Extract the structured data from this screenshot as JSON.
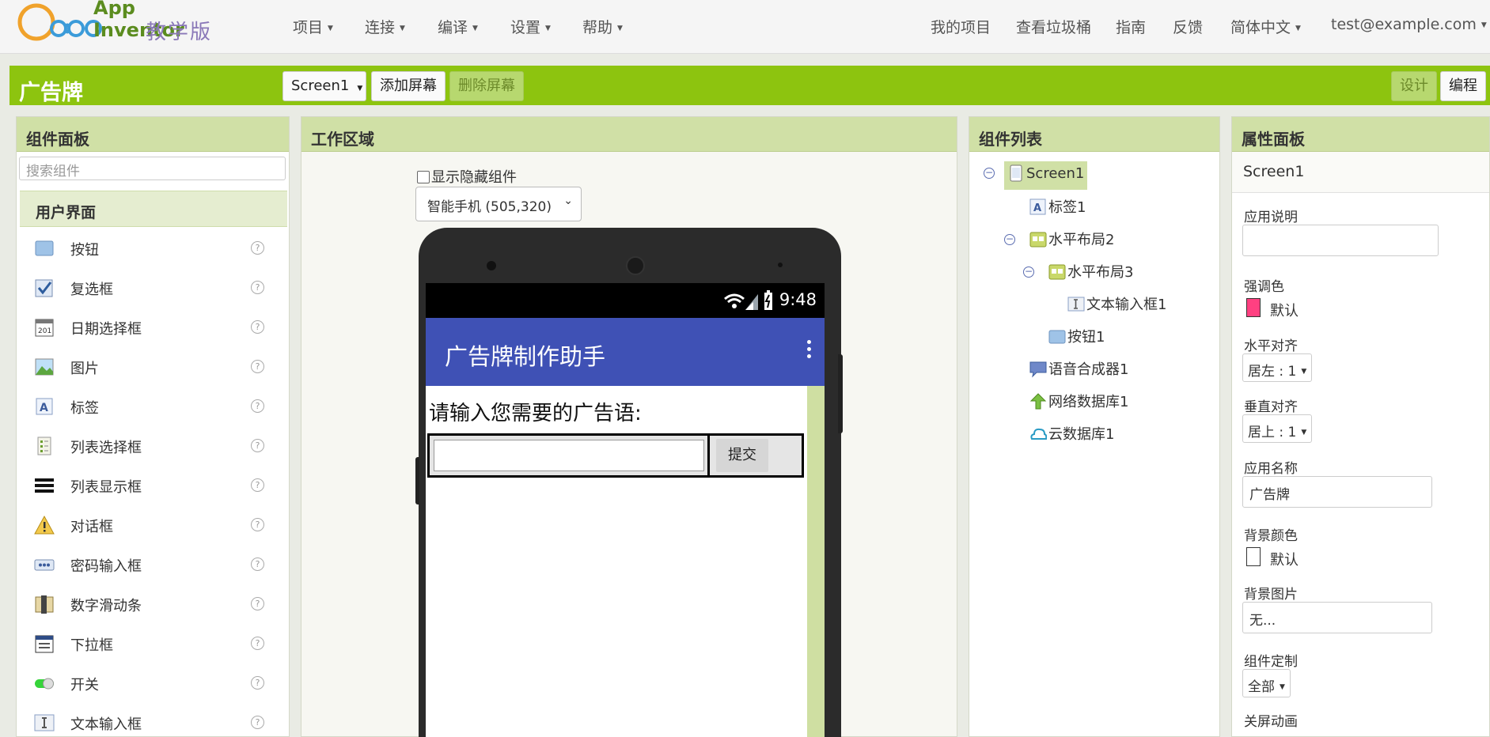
{
  "brand": {
    "title": "App Inventor",
    "subtitle": "教学版"
  },
  "topnav": {
    "menus": [
      {
        "label": "项目"
      },
      {
        "label": "连接"
      },
      {
        "label": "编译"
      },
      {
        "label": "设置"
      },
      {
        "label": "帮助"
      }
    ],
    "links": {
      "my_projects": "我的项目",
      "trash": "查看垃圾桶",
      "guide": "指南",
      "feedback": "反馈",
      "language": "简体中文",
      "user": "test@example.com"
    }
  },
  "toolbar": {
    "project_name": "广告牌",
    "screen_select": "Screen1",
    "add_screen": "添加屏幕",
    "remove_screen": "删除屏幕",
    "design": "设计",
    "blocks": "编程"
  },
  "palette": {
    "title": "组件面板",
    "search_placeholder": "搜索组件",
    "section": "用户界面",
    "items": [
      {
        "label": "按钮",
        "icon": "button-icon"
      },
      {
        "label": "复选框",
        "icon": "checkbox-icon"
      },
      {
        "label": "日期选择框",
        "icon": "calendar-icon"
      },
      {
        "label": "图片",
        "icon": "image-icon"
      },
      {
        "label": "标签",
        "icon": "label-icon"
      },
      {
        "label": "列表选择框",
        "icon": "list-picker-icon"
      },
      {
        "label": "列表显示框",
        "icon": "list-view-icon"
      },
      {
        "label": "对话框",
        "icon": "warning-icon"
      },
      {
        "label": "密码输入框",
        "icon": "password-icon"
      },
      {
        "label": "数字滑动条",
        "icon": "slider-icon"
      },
      {
        "label": "下拉框",
        "icon": "spinner-icon"
      },
      {
        "label": "开关",
        "icon": "switch-icon"
      },
      {
        "label": "文本输入框",
        "icon": "textbox-icon"
      }
    ],
    "help_glyph": "?"
  },
  "viewer": {
    "title": "工作区域",
    "show_hidden": "显示隐藏组件",
    "size_option": "智能手机 (505,320)",
    "phone": {
      "time": "9:48",
      "app_title": "广告牌制作助手",
      "prompt": "请输入您需要的广告语:",
      "submit": "提交"
    }
  },
  "tree": {
    "title": "组件列表",
    "nodes": [
      {
        "label": "Screen1",
        "icon": "screen-icon"
      },
      {
        "label": "标签1",
        "icon": "label-icon"
      },
      {
        "label": "水平布局2",
        "icon": "horizontal-arrangement-icon"
      },
      {
        "label": "水平布局3",
        "icon": "horizontal-arrangement-icon"
      },
      {
        "label": "文本输入框1",
        "icon": "textbox-icon"
      },
      {
        "label": "按钮1",
        "icon": "button-icon"
      },
      {
        "label": "语音合成器1",
        "icon": "text-to-speech-icon"
      },
      {
        "label": "网络数据库1",
        "icon": "tinywebdb-icon"
      },
      {
        "label": "云数据库1",
        "icon": "clouddb-icon"
      }
    ]
  },
  "properties": {
    "title": "属性面板",
    "component": "Screen1",
    "about_label": "应用说明",
    "about_value": "",
    "accent_label": "强调色",
    "accent_value": "默认",
    "accent_color": "#ff4081",
    "halign_label": "水平对齐",
    "halign_value": "居左 : 1",
    "valign_label": "垂直对齐",
    "valign_value": "居上 : 1",
    "appname_label": "应用名称",
    "appname_value": "广告牌",
    "bgcolor_label": "背景颜色",
    "bgcolor_value": "默认",
    "bgimage_label": "背景图片",
    "bgimage_value": "无...",
    "blocks_label": "组件定制",
    "blocks_value": "全部",
    "anim_label": "关屏动画"
  },
  "colors": {
    "accent_green": "#8dc40f",
    "panel_header": "#d0e0a6",
    "appbar_blue": "#3f51b5"
  }
}
